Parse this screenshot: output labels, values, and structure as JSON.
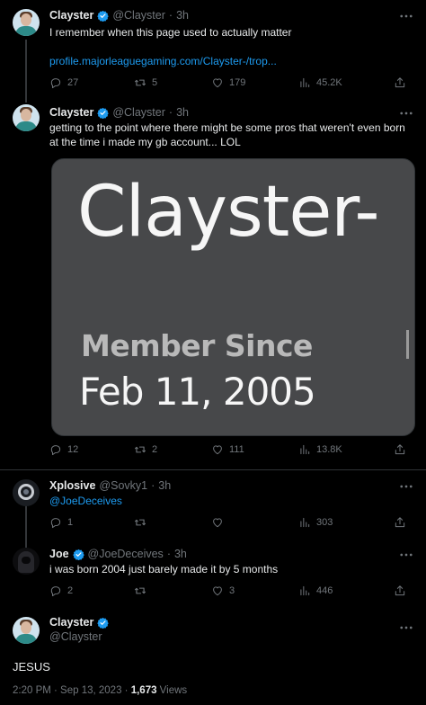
{
  "tweets": [
    {
      "name": "Clayster",
      "handle": "@Clayster",
      "time": "3h",
      "text": "I remember when this page used to actually matter",
      "link": "profile.majorleaguegaming.com/Clayster-/trop...",
      "replies": "27",
      "retweets": "5",
      "likes": "179",
      "views": "45.2K"
    },
    {
      "name": "Clayster",
      "handle": "@Clayster",
      "time": "3h",
      "text_line1": "getting to the point where there might be some pros that weren't even born",
      "text_line2": "at the time i made my gb account... LOL",
      "media": {
        "title": "Clayster-",
        "member_since_label": "Member Since",
        "member_since_date": "Feb 11, 2005"
      },
      "replies": "12",
      "retweets": "2",
      "likes": "111",
      "views": "13.8K"
    },
    {
      "name": "Xplosive",
      "handle": "@Sovky1",
      "time": "3h",
      "text": "@JoeDeceives",
      "replies": "1",
      "retweets": "",
      "likes": "",
      "views": "303"
    },
    {
      "name": "Joe",
      "handle": "@JoeDeceives",
      "time": "3h",
      "text": "i was born 2004 just barely  made it by 5 months",
      "replies": "2",
      "retweets": "",
      "likes": "3",
      "views": "446"
    }
  ],
  "main": {
    "name": "Clayster",
    "handle": "@Clayster",
    "text": "JESUS",
    "timestamp": "2:20 PM · Sep 13, 2023 · ",
    "views_count": "1,673",
    "views_label": " Views"
  },
  "separator": "·",
  "icons": [
    "more-icon",
    "reply-icon",
    "retweet-icon",
    "like-icon",
    "views-icon",
    "share-icon",
    "verified-badge-icon"
  ],
  "colors": {
    "background": "#000000",
    "text": "#e7e9ea",
    "muted": "#71767b",
    "link": "#1d9bf0",
    "verified": "#1d9bf0"
  }
}
